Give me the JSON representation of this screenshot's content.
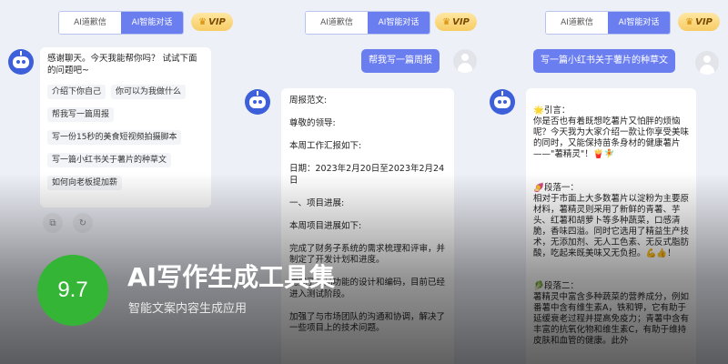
{
  "tabs": {
    "writing_letter": "AI道歉信",
    "smart_chat": "AI智能对话"
  },
  "vip_label": "VIP",
  "panel1": {
    "greeting": "感谢聊天。今天我能帮你吗？ 试试下面的问题吧~",
    "suggestions": [
      "介绍下你自己",
      "你可以为我做什么",
      "帮我写一篇周报",
      "写一份15秒的美食短视频拍摄脚本",
      "写一篇小红书关于薯片的种草文",
      "如何向老板提加薪"
    ]
  },
  "panel2": {
    "user_message": "帮我写一篇周报",
    "reply": [
      "周报范文:",
      "尊敬的领导:",
      "本周工作汇报如下:",
      "日期：2023年2月20日至2023年2月24日",
      "一、项目进展:",
      "本周项目进展如下:",
      "完成了财务子系统的需求梳理和评审，并制定了开发计划和进度。",
      "完成了商品功能的设计和编码，目前已经进入测试阶段。",
      "加强了与市场团队的沟通和协调，解决了一些项目上的技术问题。"
    ]
  },
  "panel3": {
    "user_message": "写一篇小红书关于薯片的种草文",
    "reply": [
      "🌟引言：\n你是否也有着既想吃薯片又怕胖的烦恼呢？今天我为大家介绍一款让你享受美味的同时，又能保持苗条身材的健康薯片——\"薯精灵\"！🍟🧚",
      "🍠段落一：\n相对于市面上大多数薯片以淀粉为主要原材料，薯精灵则采用了新鲜的青薯、芋头、红薯和胡萝卜等多种蔬菜，口感清脆，香味四溢。同时它选用了精益生产技术，无添加剂、无人工色素、无反式脂肪酸，吃起来既美味又无负担。💪👍！",
      "🥬段落二：\n薯精灵中富含多种蔬菜的营养成分，例如番薯中含有维生素A，铁和钾，它有助于延缓衰老过程并提高免疫力；青薯中含有丰富的抗氧化物和维生素C，有助于维持皮肤和血管的健康。此外"
    ]
  },
  "overlay": {
    "score": "9.7",
    "title": "AI写作生成工具集",
    "subtitle": "智能文案内容生成应用"
  }
}
